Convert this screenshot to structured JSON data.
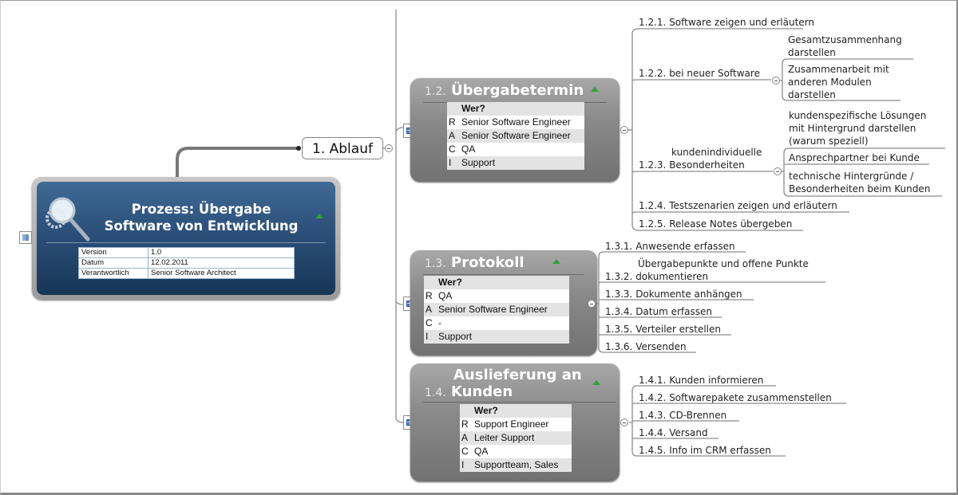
{
  "root": {
    "title_line1": "Prozess: Übergabe",
    "title_line2": "Software von Entwicklung",
    "properties": [
      {
        "key": "Version",
        "value": "1.0"
      },
      {
        "key": "Datum",
        "value": "12.02.2011"
      },
      {
        "key": "Verantwortlich",
        "value": "Senior Software Architect"
      }
    ],
    "icon": "magnifier-gear-icon"
  },
  "main_topic": {
    "label": "1. Ablauf"
  },
  "subtopics": [
    {
      "number": "1.2.",
      "title": "Übergabetermin",
      "table_header": "Wer?",
      "raci": [
        {
          "role": "R",
          "who": "Senior Software Engineer"
        },
        {
          "role": "A",
          "who": "Senior Software Engineer"
        },
        {
          "role": "C",
          "who": "QA"
        },
        {
          "role": "I",
          "who": "Support"
        }
      ],
      "children": [
        {
          "number": "1.2.1.",
          "label": "Software zeigen und erläutern"
        },
        {
          "number": "1.2.2.",
          "label": "bei neuer Software",
          "children": [
            "Gesamtzusammenhang darstellen",
            "Zusammenarbeit mit anderen Modulen darstellen"
          ],
          "children_lines": [
            [
              "Gesamtzusammenhang",
              "darstellen"
            ],
            [
              "Zusammenarbeit mit",
              "anderen Modulen",
              "darstellen"
            ]
          ]
        },
        {
          "number": "1.2.3.",
          "label_line1": "kundenindividuelle",
          "label_line2": "Besonderheiten",
          "children_lines": [
            [
              "kundenspezifische Lösungen",
              "mit Hintergrund darstellen",
              "(warum speziell)"
            ],
            [
              "Ansprechpartner bei Kunde"
            ],
            [
              "technische Hintergründe /",
              "Besonderheiten beim Kunden"
            ]
          ]
        },
        {
          "number": "1.2.4.",
          "label": "Testszenarien zeigen und erläutern"
        },
        {
          "number": "1.2.5.",
          "label": "Release Notes übergeben"
        }
      ]
    },
    {
      "number": "1.3.",
      "title": "Protokoll",
      "table_header": "Wer?",
      "raci": [
        {
          "role": "R",
          "who": "QA"
        },
        {
          "role": "A",
          "who": "Senior Software Engineer"
        },
        {
          "role": "C",
          "who": "-"
        },
        {
          "role": "I",
          "who": "Support"
        }
      ],
      "children": [
        {
          "number": "1.3.1.",
          "label": "Anwesende erfassen"
        },
        {
          "number": "1.3.2.",
          "label_line1": "Übergabepunkte und offene Punkte",
          "label_line2": "dokumentieren"
        },
        {
          "number": "1.3.3.",
          "label": "Dokumente anhängen"
        },
        {
          "number": "1.3.4.",
          "label": "Datum erfassen"
        },
        {
          "number": "1.3.5.",
          "label": "Verteiler erstellen"
        },
        {
          "number": "1.3.6.",
          "label": "Versenden"
        }
      ]
    },
    {
      "number": "1.4.",
      "title_line1": "Auslieferung an",
      "title_line2": "Kunden",
      "table_header": "Wer?",
      "raci": [
        {
          "role": "R",
          "who": "Support Engineer"
        },
        {
          "role": "A",
          "who": "Leiter Support"
        },
        {
          "role": "C",
          "who": "QA"
        },
        {
          "role": "I",
          "who": "Supportteam, Sales"
        }
      ],
      "children": [
        {
          "number": "1.4.1.",
          "label": "Kunden informieren"
        },
        {
          "number": "1.4.2.",
          "label": "Softwarepakete zusammenstellen"
        },
        {
          "number": "1.4.3.",
          "label": "CD-Brennen"
        },
        {
          "number": "1.4.4.",
          "label": "Versand"
        },
        {
          "number": "1.4.5.",
          "label": "Info im CRM erfassen"
        }
      ]
    }
  ],
  "colors": {
    "root_fill": "#2b5079",
    "node_fill": "#8a8a8a",
    "collapse_marker": "#2fa236",
    "table_icon": "#4a79c2"
  }
}
